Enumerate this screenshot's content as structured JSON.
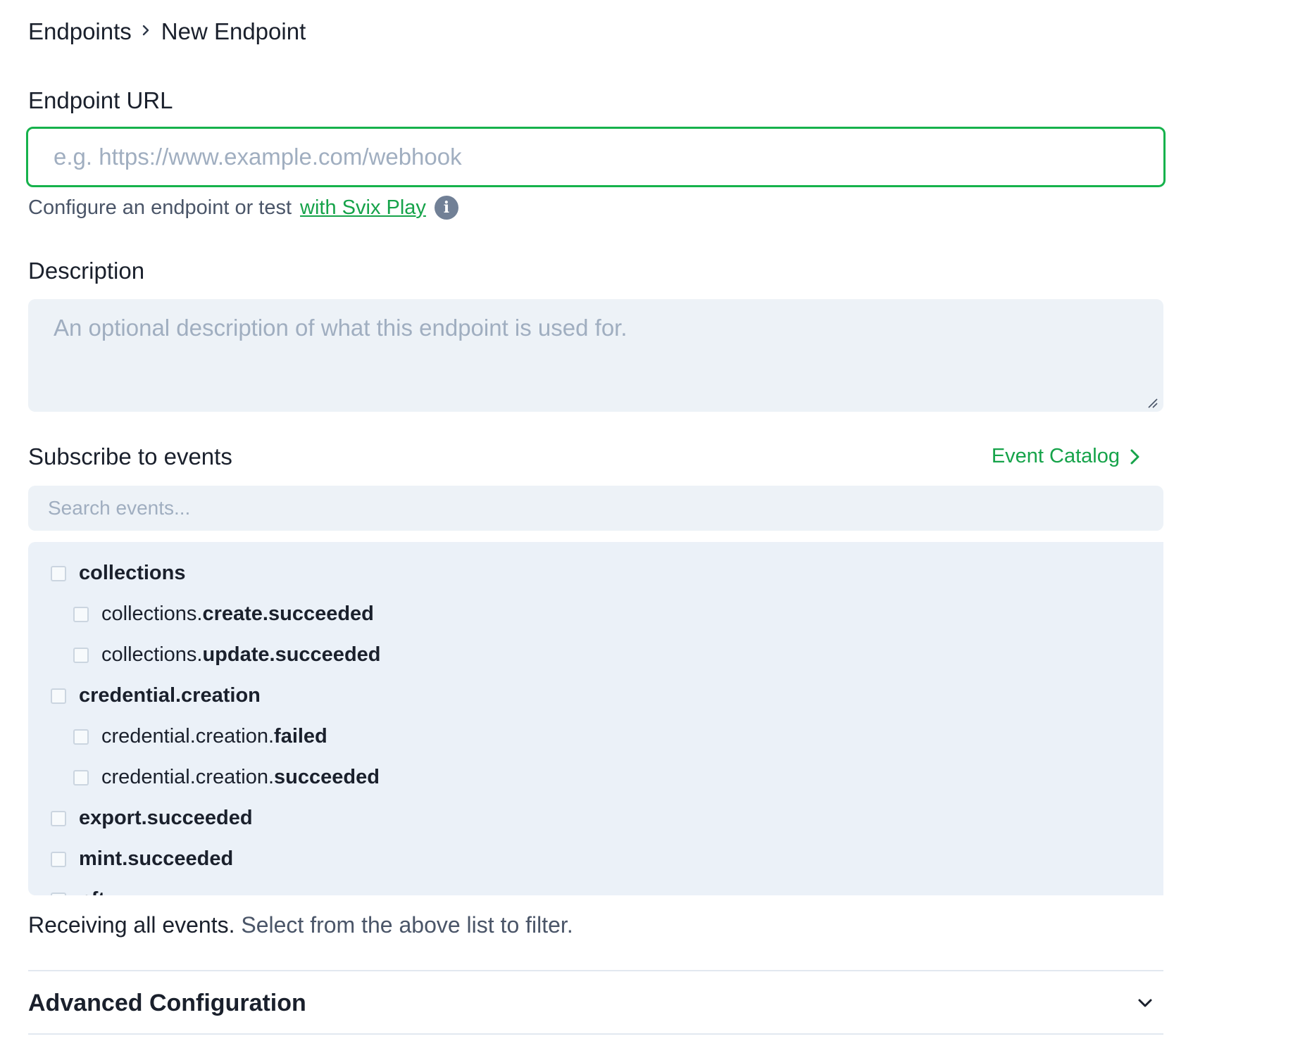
{
  "breadcrumb": {
    "parent": "Endpoints",
    "current": "New Endpoint"
  },
  "url_field": {
    "label": "Endpoint URL",
    "placeholder": "e.g. https://www.example.com/webhook",
    "value": ""
  },
  "help": {
    "text": "Configure an endpoint or test",
    "link": "with Svix Play",
    "icon": "info-icon"
  },
  "description_field": {
    "label": "Description",
    "placeholder": "An optional description of what this endpoint is used for.",
    "value": ""
  },
  "subscribe": {
    "label": "Subscribe to events",
    "catalog_link": "Event Catalog",
    "search_placeholder": "Search events..."
  },
  "events": [
    {
      "prefix": "",
      "suffix": "collections",
      "level": 0,
      "checked": false
    },
    {
      "prefix": "collections.",
      "suffix": "create.succeeded",
      "level": 1,
      "checked": false
    },
    {
      "prefix": "collections.",
      "suffix": "update.succeeded",
      "level": 1,
      "checked": false
    },
    {
      "prefix": "",
      "suffix": "credential.creation",
      "level": 0,
      "checked": false
    },
    {
      "prefix": "credential.creation.",
      "suffix": "failed",
      "level": 1,
      "checked": false
    },
    {
      "prefix": "credential.creation.",
      "suffix": "succeeded",
      "level": 1,
      "checked": false
    },
    {
      "prefix": "",
      "suffix": "export.succeeded",
      "level": 0,
      "checked": false
    },
    {
      "prefix": "",
      "suffix": "mint.succeeded",
      "level": 0,
      "checked": false
    },
    {
      "prefix": "",
      "suffix": "nft",
      "level": 0,
      "checked": false
    }
  ],
  "receiving": {
    "main": "Receiving all events.",
    "hint": "Select from the above list to filter."
  },
  "advanced": {
    "title": "Advanced Configuration"
  },
  "colors": {
    "accent": "#16a34a",
    "field_bg": "#edf2f7",
    "list_bg": "#ebf1f8"
  }
}
